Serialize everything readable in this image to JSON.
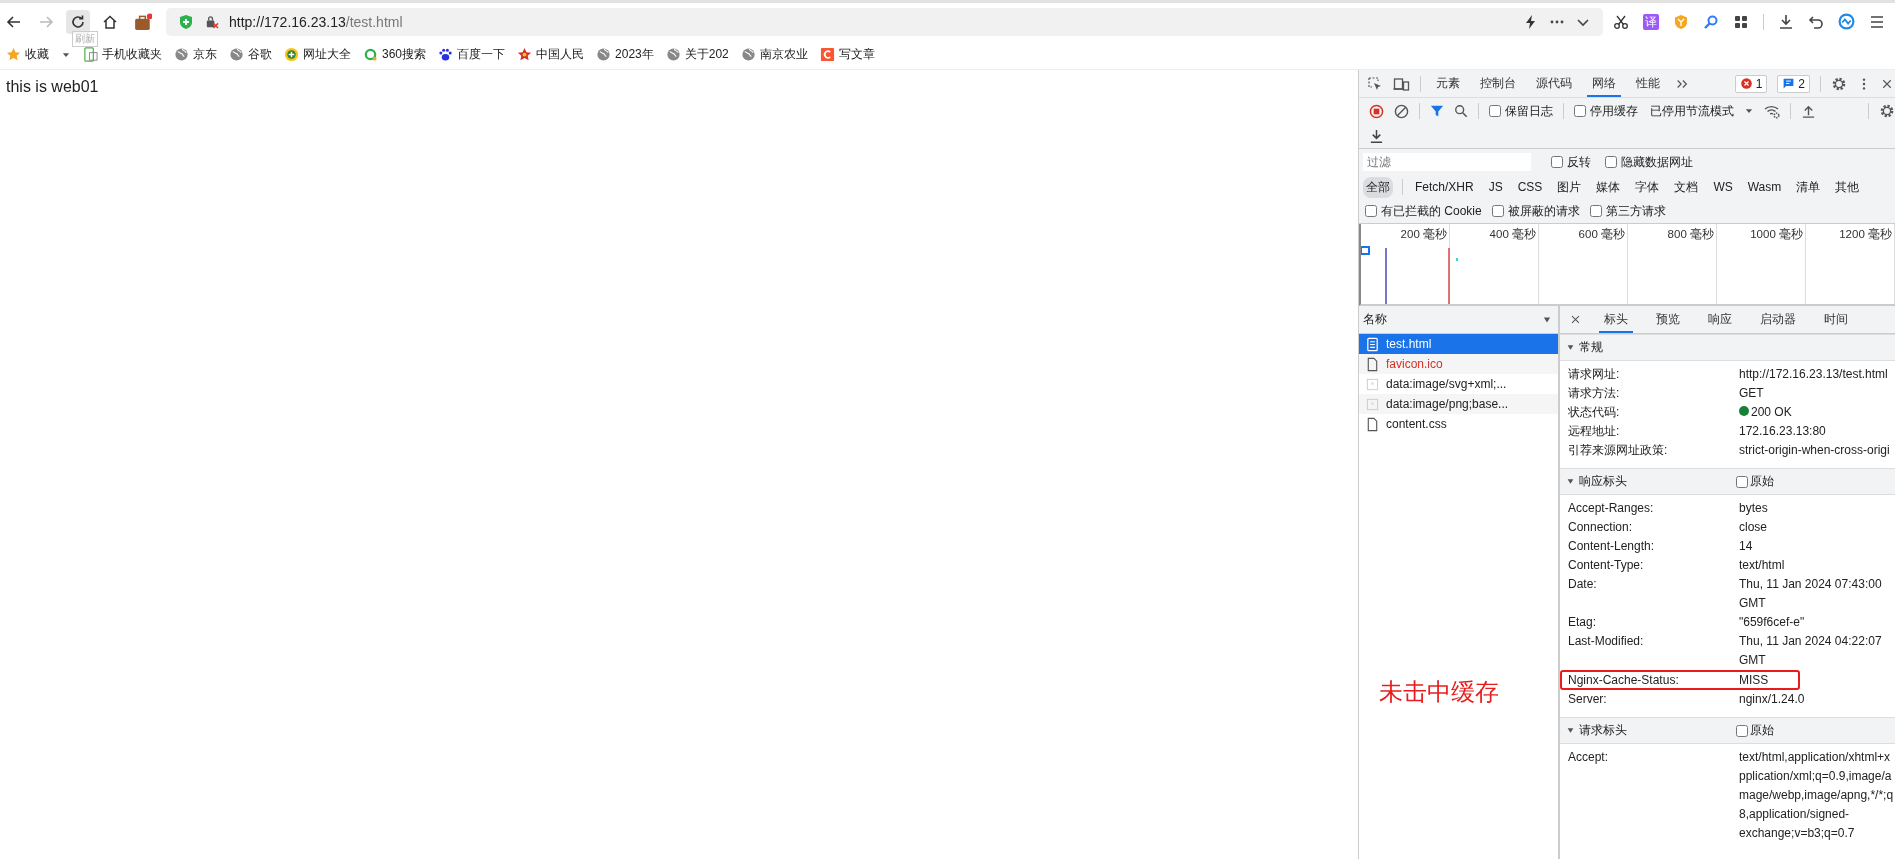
{
  "browser": {
    "back_enabled": true,
    "forward_enabled": false,
    "url_host": "http://172.16.23.13",
    "url_path": "/test.html",
    "tooltip": "刷新",
    "translate_label": "译"
  },
  "bookmarks": [
    {
      "label": "收藏",
      "kind": "star"
    },
    {
      "label": "手机收藏夹",
      "kind": "phone"
    },
    {
      "label": "京东",
      "kind": "globe"
    },
    {
      "label": "谷歌",
      "kind": "globe"
    },
    {
      "label": "网址大全",
      "kind": "plus"
    },
    {
      "label": "360搜索",
      "kind": "ring"
    },
    {
      "label": "百度一下",
      "kind": "paw"
    },
    {
      "label": "中国人民",
      "kind": "redstar"
    },
    {
      "label": "2023年",
      "kind": "globe"
    },
    {
      "label": "关于202",
      "kind": "globe"
    },
    {
      "label": "南京农业",
      "kind": "globe"
    },
    {
      "label": "写文章",
      "kind": "orange"
    }
  ],
  "page": {
    "text": "this is web01"
  },
  "annotation": {
    "text": "未击中缓存"
  },
  "devtools": {
    "tabs": [
      {
        "label": "元素",
        "selected": false
      },
      {
        "label": "控制台",
        "selected": false
      },
      {
        "label": "源代码",
        "selected": false
      },
      {
        "label": "网络",
        "selected": true
      },
      {
        "label": "性能",
        "selected": false
      }
    ],
    "error_count": "1",
    "message_count": "2",
    "recording": true,
    "filter_active": true,
    "toolbar_options": [
      {
        "label": "保留日志",
        "checked": false
      },
      {
        "label": "停用缓存",
        "checked": false
      }
    ],
    "throttling": "已停用节流模式",
    "filter": {
      "placeholder": "过滤",
      "options": [
        {
          "label": "反转",
          "checked": false
        },
        {
          "label": "隐藏数据网址",
          "checked": false
        }
      ]
    },
    "types": [
      {
        "label": "全部",
        "selected": true
      },
      {
        "label": "Fetch/XHR",
        "selected": false
      },
      {
        "label": "JS",
        "selected": false
      },
      {
        "label": "CSS",
        "selected": false
      },
      {
        "label": "图片",
        "selected": false
      },
      {
        "label": "媒体",
        "selected": false
      },
      {
        "label": "字体",
        "selected": false
      },
      {
        "label": "文档",
        "selected": false
      },
      {
        "label": "WS",
        "selected": false
      },
      {
        "label": "Wasm",
        "selected": false
      },
      {
        "label": "清单",
        "selected": false
      },
      {
        "label": "其他",
        "selected": false
      }
    ],
    "extra_filters": [
      {
        "label": "有已拦截的 Cookie",
        "checked": false
      },
      {
        "label": "被屏蔽的请求",
        "checked": false
      },
      {
        "label": "第三方请求",
        "checked": false
      }
    ],
    "timeline_ticks": [
      "200 毫秒",
      "400 毫秒",
      "600 毫秒",
      "800 毫秒",
      "1000 毫秒",
      "1200 毫秒"
    ],
    "requests": {
      "column": "名称",
      "items": [
        {
          "name": "test.html",
          "kind": "document",
          "selected": true,
          "failed": false
        },
        {
          "name": "favicon.ico",
          "kind": "file",
          "selected": false,
          "failed": true
        },
        {
          "name": "data:image/svg+xml;...",
          "kind": "image",
          "selected": false,
          "failed": false
        },
        {
          "name": "data:image/png;base...",
          "kind": "image",
          "selected": false,
          "failed": false
        },
        {
          "name": "content.css",
          "kind": "file",
          "selected": false,
          "failed": false
        }
      ]
    },
    "details": {
      "tabs": [
        {
          "label": "标头",
          "selected": true
        },
        {
          "label": "预览",
          "selected": false
        },
        {
          "label": "响应",
          "selected": false
        },
        {
          "label": "启动器",
          "selected": false
        },
        {
          "label": "时间",
          "selected": false
        }
      ],
      "sections": [
        {
          "title": "常规",
          "expanded": true,
          "rows": [
            {
              "name": "请求网址:",
              "value": "http://172.16.23.13/test.html",
              "highlighted": false
            },
            {
              "name": "请求方法:",
              "value": "GET",
              "highlighted": false
            },
            {
              "name": "状态代码:",
              "value": "200 OK",
              "color": "#188038",
              "highlighted": false
            },
            {
              "name": "远程地址:",
              "value": "172.16.23.13:80",
              "highlighted": false
            },
            {
              "name": "引荐来源网址政策:",
              "value": "strict-origin-when-cross-origi",
              "highlighted": false
            }
          ]
        },
        {
          "title": "响应标头",
          "expanded": true,
          "raw": {
            "label": "原始",
            "checked": false
          },
          "rows": [
            {
              "name": "Accept-Ranges:",
              "value": "bytes",
              "highlighted": false
            },
            {
              "name": "Connection:",
              "value": "close",
              "highlighted": false
            },
            {
              "name": "Content-Length:",
              "value": "14",
              "highlighted": false
            },
            {
              "name": "Content-Type:",
              "value": "text/html",
              "highlighted": false
            },
            {
              "name": "Date:",
              "value": "Thu, 11 Jan 2024 07:43:00\nGMT",
              "highlighted": false
            },
            {
              "name": "Etag:",
              "value": "\"659f6cef-e\"",
              "highlighted": false
            },
            {
              "name": "Last-Modified:",
              "value": "Thu, 11 Jan 2024 04:22:07\nGMT",
              "highlighted": false
            },
            {
              "name": "Nginx-Cache-Status:",
              "value": "MISS",
              "highlighted": true
            },
            {
              "name": "Server:",
              "value": "nginx/1.24.0",
              "highlighted": false
            }
          ]
        },
        {
          "title": "请求标头",
          "expanded": true,
          "raw": {
            "label": "原始",
            "checked": false
          },
          "rows": [
            {
              "name": "Accept:",
              "value": "text/html,application/xhtml+x\npplication/xml;q=0.9,image/a\nmage/webp,image/apng,*/*;q\n8,application/signed-\nexchange;v=b3;q=0.7",
              "highlighted": false
            }
          ]
        }
      ]
    }
  }
}
